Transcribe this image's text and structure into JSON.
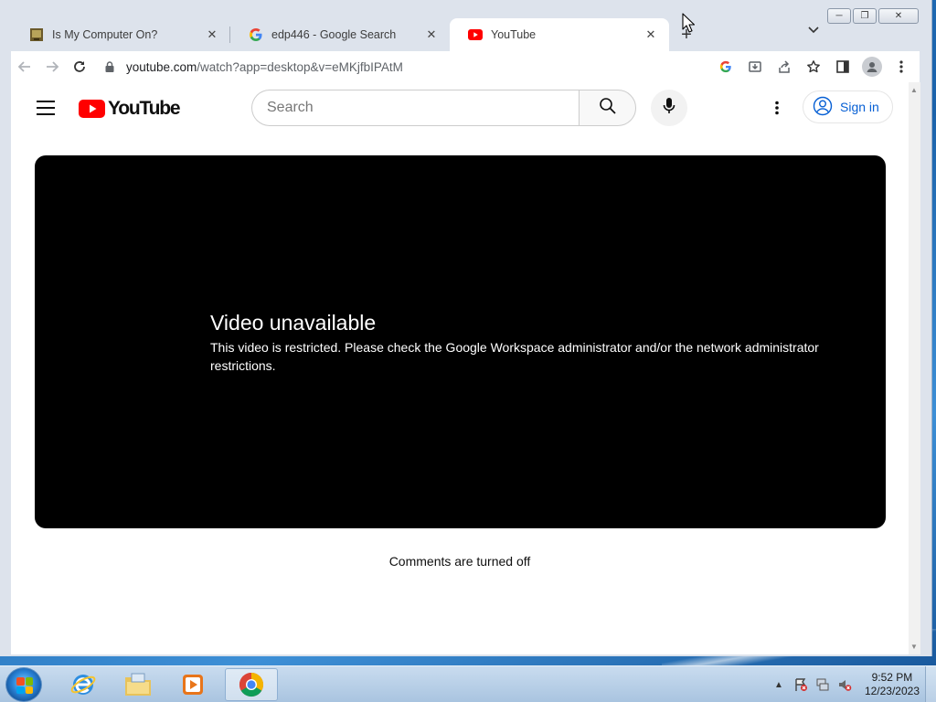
{
  "browser": {
    "tabs": [
      {
        "title": "Is My Computer On?",
        "favicon": "computer-icon",
        "active": false
      },
      {
        "title": "edp446 - Google Search",
        "favicon": "google-g-icon",
        "active": false
      },
      {
        "title": "YouTube",
        "favicon": "youtube-icon",
        "active": true
      }
    ],
    "new_tab_label": "+",
    "address_bar": {
      "host": "youtube.com",
      "path": "/watch?app=desktop&v=eMKjfbIPAtM"
    },
    "toolbar_icons": [
      "google-lens-icon",
      "install-app-icon",
      "share-icon",
      "bookmark-star-icon",
      "side-panel-icon",
      "profile-icon",
      "menu-icon"
    ]
  },
  "youtube": {
    "logo_text": "YouTube",
    "search_placeholder": "Search",
    "sign_in_label": "Sign in",
    "error_title": "Video unavailable",
    "error_message": "This video is restricted. Please check the Google Workspace administrator and/or the network administrator restrictions.",
    "comments_status": "Comments are turned off"
  },
  "taskbar": {
    "apps": [
      "internet-explorer-icon",
      "file-explorer-icon",
      "media-player-icon",
      "chrome-icon"
    ],
    "active_app": "chrome-icon",
    "clock_time": "9:52 PM",
    "clock_date": "12/23/2023"
  },
  "colors": {
    "youtube_red": "#ff0000",
    "sign_in_blue": "#065fd4",
    "player_bg": "#000000"
  }
}
